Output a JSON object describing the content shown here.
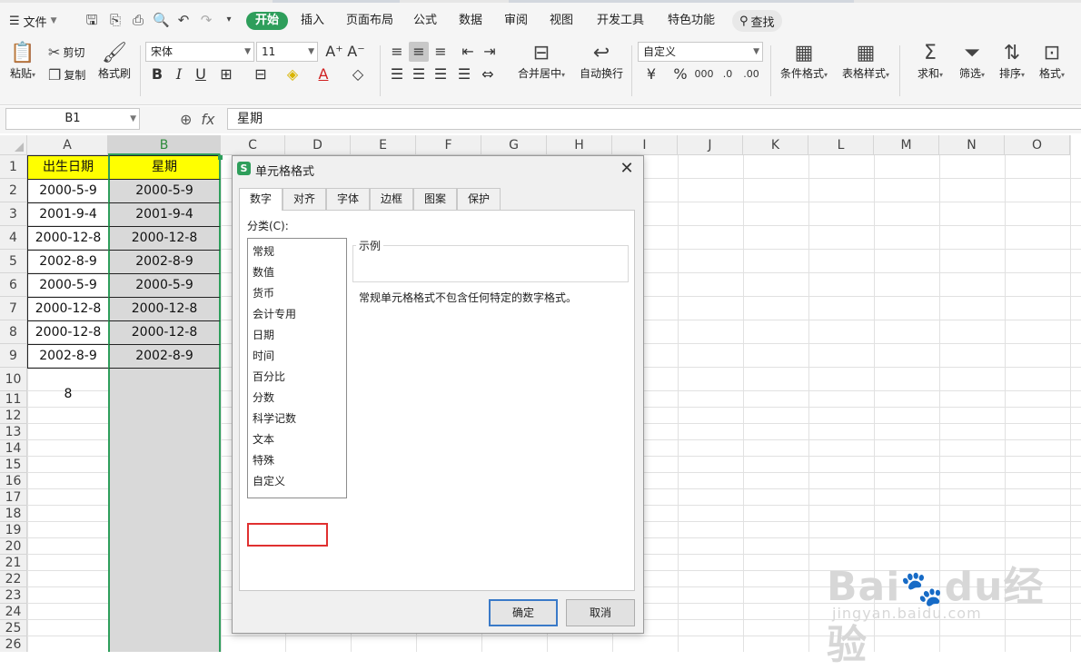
{
  "menubar": {
    "file_label": "文件",
    "tabs": [
      {
        "label": "开始",
        "active": true
      },
      {
        "label": "插入"
      },
      {
        "label": "页面布局"
      },
      {
        "label": "公式"
      },
      {
        "label": "数据"
      },
      {
        "label": "审阅"
      },
      {
        "label": "视图"
      },
      {
        "label": "开发工具"
      },
      {
        "label": "特色功能"
      }
    ],
    "search_label": "查找"
  },
  "ribbon": {
    "paste": "粘贴",
    "cut": "剪切",
    "copy": "复制",
    "format_painter": "格式刷",
    "font_name": "宋体",
    "font_size": "11",
    "merge_center": "合并居中",
    "wrap_text": "自动换行",
    "number_format": "自定义",
    "conditional_format": "条件格式",
    "table_style": "表格样式",
    "sum": "求和",
    "filter": "筛选",
    "sort": "排序",
    "format": "格式"
  },
  "formula_bar": {
    "name_box": "B1",
    "fx": "fx",
    "content": "星期"
  },
  "grid": {
    "columns": [
      "A",
      "B",
      "C",
      "D",
      "E",
      "F",
      "G",
      "H",
      "I",
      "J",
      "K",
      "L",
      "M",
      "N",
      "O"
    ],
    "rows": [
      "1",
      "2",
      "3",
      "4",
      "5",
      "6",
      "7",
      "8",
      "9",
      "10",
      "11",
      "12",
      "13",
      "14",
      "15",
      "16",
      "17",
      "18",
      "19",
      "20",
      "21",
      "22",
      "23",
      "24",
      "25",
      "26"
    ],
    "header_a": "出生日期",
    "header_b": "星期",
    "col_a": [
      "2000-5-9",
      "2001-9-4",
      "2000-12-8",
      "2002-8-9",
      "2000-5-9",
      "2000-12-8",
      "2000-12-8",
      "2002-8-9"
    ],
    "col_b": [
      "2000-5-9",
      "2001-9-4",
      "2000-12-8",
      "2002-8-9",
      "2000-5-9",
      "2000-12-8",
      "2000-12-8",
      "2002-8-9"
    ],
    "a11": "8"
  },
  "dialog": {
    "title": "单元格格式",
    "tabs": [
      "数字",
      "对齐",
      "字体",
      "边框",
      "图案",
      "保护"
    ],
    "category_label": "分类(C):",
    "categories": [
      "常规",
      "数值",
      "货币",
      "会计专用",
      "日期",
      "时间",
      "百分比",
      "分数",
      "科学记数",
      "文本",
      "特殊",
      "自定义"
    ],
    "sample_label": "示例",
    "description": "常规单元格格式不包含任何特定的数字格式。",
    "ok": "确定",
    "cancel": "取消"
  },
  "watermark": {
    "logo": "Baidu经验",
    "url": "jingyan.baidu.com"
  }
}
